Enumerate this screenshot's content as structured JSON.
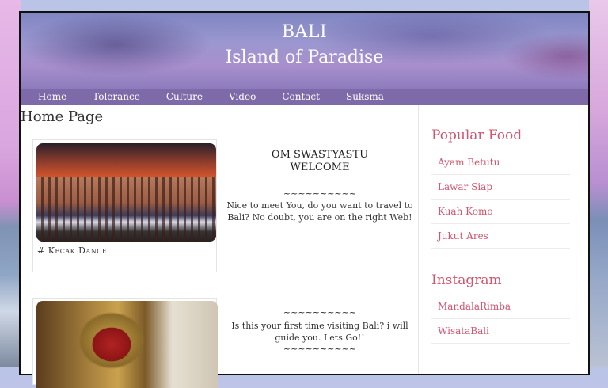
{
  "header": {
    "title": "BALI",
    "subtitle": "Island of Paradise"
  },
  "nav": {
    "items": [
      "Home",
      "Tolerance",
      "Culture",
      "Video",
      "Contact",
      "Suksma"
    ]
  },
  "main": {
    "title": "Home Page",
    "card1": {
      "caption": "# Kecak Dance"
    },
    "welcome": {
      "title_line1": "OM SWASTYASTU",
      "title_line2": "WELCOME",
      "tilde": "~~~~~~~~~~",
      "text1": "Nice to meet You, do you want to travel to Bali? No doubt, you are on the right Web!",
      "text2": "Is this your first time visiting Bali? i will guide you. Lets Go!!"
    }
  },
  "sidebar": {
    "food_title": "Popular Food",
    "food_items": [
      "Ayam Betutu",
      "Lawar Siap",
      "Kuah Komo",
      "Jukut Ares"
    ],
    "insta_title": "Instagram",
    "insta_items": [
      "MandalaRimba",
      "WisataBali"
    ]
  },
  "colors": {
    "nav_bg": "#7e6aa9",
    "accent": "#d0566f"
  }
}
